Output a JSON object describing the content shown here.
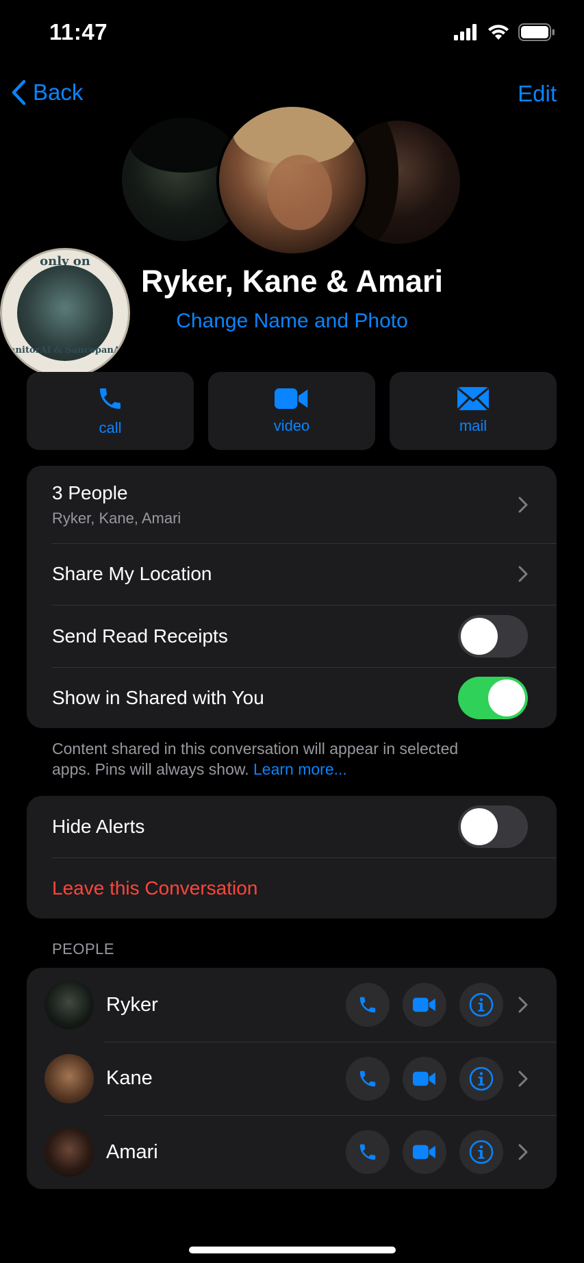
{
  "status_bar": {
    "time": "11:47"
  },
  "nav": {
    "back_label": "Back",
    "edit_label": "Edit"
  },
  "sticker": {
    "top_text": "only on",
    "bottom_text": "JanitorAI & SaucepanAI"
  },
  "header": {
    "group_name": "Ryker, Kane & Amari",
    "change_link": "Change Name and Photo"
  },
  "actions": [
    {
      "label": "call",
      "icon": "phone-icon"
    },
    {
      "label": "video",
      "icon": "video-icon"
    },
    {
      "label": "mail",
      "icon": "mail-icon"
    }
  ],
  "settings": {
    "people_count": "3 People",
    "people_names": "Ryker, Kane, Amari",
    "share_location": "Share My Location",
    "read_receipts": {
      "label": "Send Read Receipts",
      "on": false
    },
    "shared_with_you": {
      "label": "Show in Shared with You",
      "on": true
    },
    "footnote": "Content shared in this conversation will appear in selected apps. Pins will always show.",
    "learn_more": "Learn more..."
  },
  "alerts": {
    "hide_alerts": {
      "label": "Hide Alerts",
      "on": false
    },
    "leave": "Leave this Conversation"
  },
  "people_section": {
    "header": "PEOPLE",
    "people": [
      {
        "name": "Ryker"
      },
      {
        "name": "Kane"
      },
      {
        "name": "Amari"
      }
    ]
  },
  "colors": {
    "accent": "#0a84ff",
    "destructive": "#ff453a",
    "toggle_on": "#30d158",
    "card": "#1c1c1e"
  }
}
